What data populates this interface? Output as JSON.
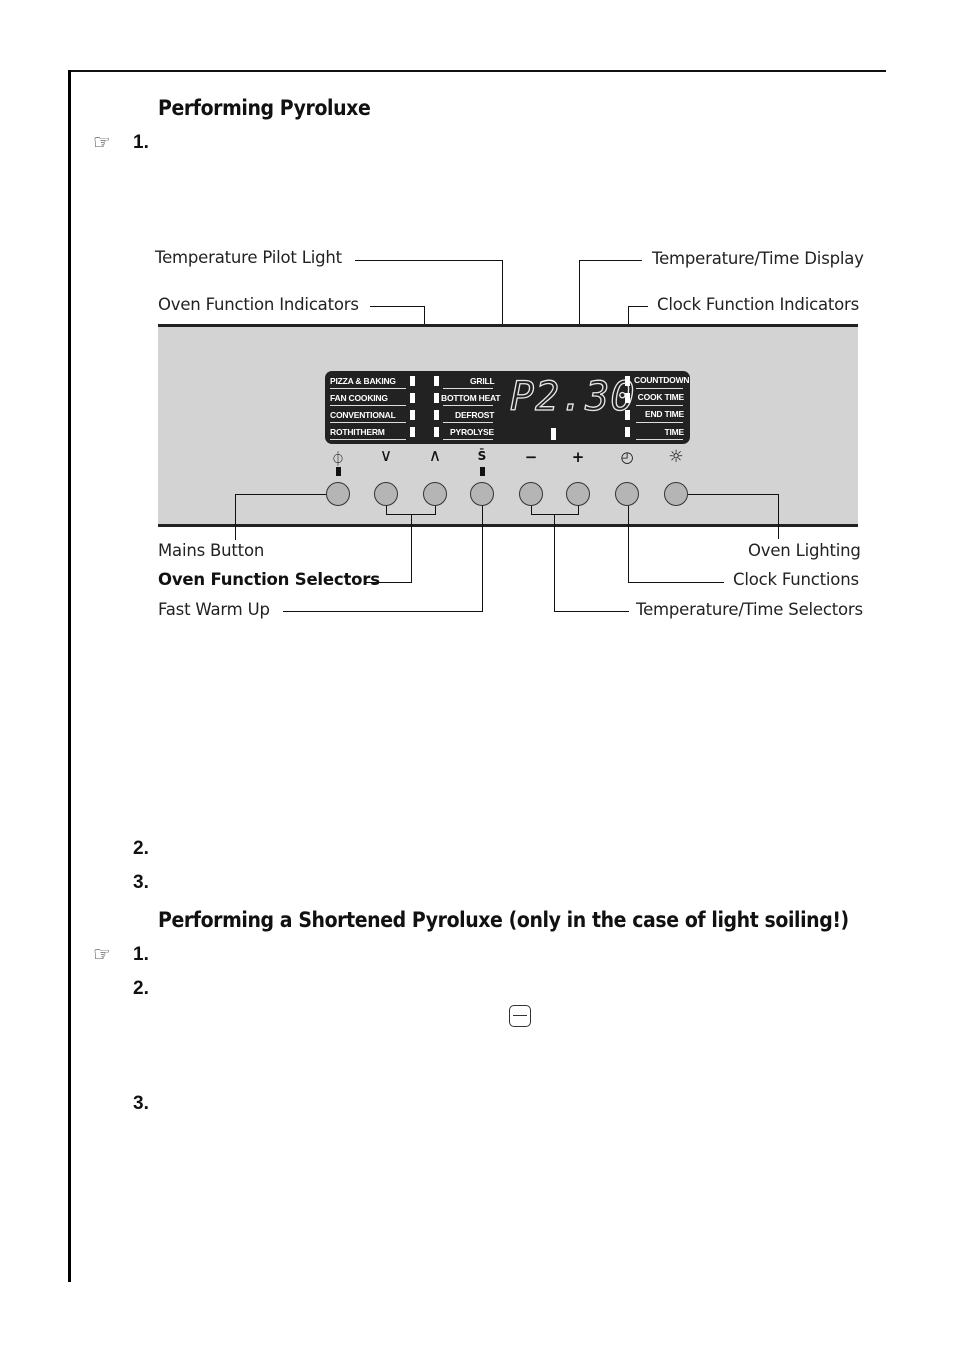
{
  "section1": {
    "heading": "Performing Pyroluxe",
    "steps": [
      "1.",
      "2.",
      "3."
    ],
    "hint_icon": "☞"
  },
  "diagram": {
    "callouts": {
      "temperature_pilot_light": "Temperature Pilot Light",
      "oven_function_indicators": "Oven Function Indicators",
      "temperature_time_display": "Temperature/Time Display",
      "clock_function_indicators": "Clock Function Indicators",
      "mains_button": "Mains Button",
      "oven_function_selectors": "Oven Function Selectors",
      "fast_warm_up": "Fast Warm Up",
      "oven_lighting": "Oven Lighting",
      "clock_functions": "Clock Functions",
      "temperature_time_selectors": "Temperature/Time Selectors"
    },
    "display": {
      "readout": "P2.30",
      "oven_functions_left": [
        "PIZZA & BAKING",
        "FAN COOKING",
        "CONVENTIONAL",
        "ROTHITHERM"
      ],
      "oven_functions_right": [
        "GRILL",
        "BOTTOM HEAT",
        "DEFROST",
        "PYROLYSE"
      ],
      "clock_functions": [
        "COUNTDOWN",
        "COOK TIME",
        "END TIME",
        "TIME"
      ]
    },
    "buttons": [
      {
        "name": "mains",
        "icon": "power-icon",
        "glyph": "⏀"
      },
      {
        "name": "function-down",
        "icon": "chevron-down-icon",
        "glyph": "∨"
      },
      {
        "name": "function-up",
        "icon": "chevron-up-icon",
        "glyph": "∧"
      },
      {
        "name": "fast-warm-up",
        "icon": "fast-warm-up-icon",
        "glyph": "S̄"
      },
      {
        "name": "minus",
        "icon": "minus-icon",
        "glyph": "−"
      },
      {
        "name": "plus",
        "icon": "plus-icon",
        "glyph": "+"
      },
      {
        "name": "clock",
        "icon": "clock-icon",
        "glyph": "◴"
      },
      {
        "name": "oven-light",
        "icon": "light-bulb-icon",
        "glyph": "☼"
      }
    ]
  },
  "section2": {
    "heading": "Performing a Shortened Pyroluxe (only in the case of light soiling!)",
    "steps": [
      "1.",
      "2.",
      "3."
    ],
    "hint_icon": "☞",
    "inline_icon": "minus-button-icon"
  }
}
